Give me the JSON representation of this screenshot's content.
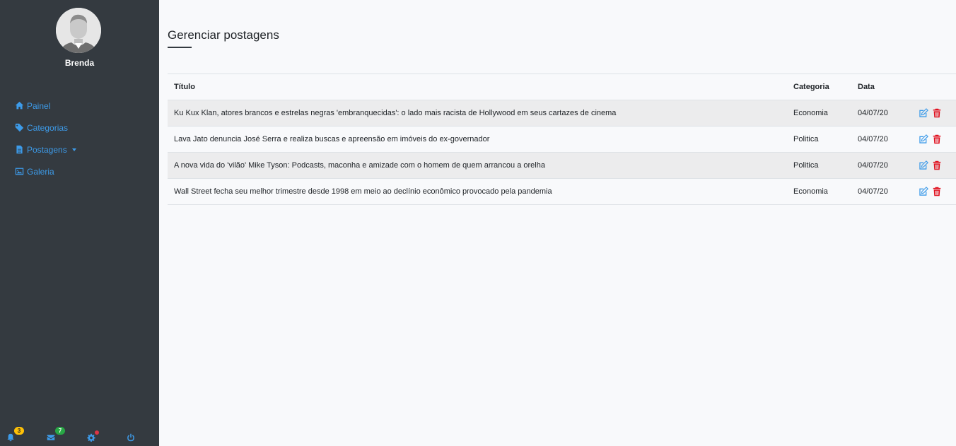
{
  "user": {
    "name": "Brenda"
  },
  "sidebar": {
    "items": [
      {
        "label": "Painel",
        "icon": "home-icon"
      },
      {
        "label": "Categorias",
        "icon": "tag-icon"
      },
      {
        "label": "Postagens",
        "icon": "file-icon",
        "has_dropdown": true
      },
      {
        "label": "Galeria",
        "icon": "image-icon"
      }
    ],
    "footer": {
      "notifications_count": "3",
      "messages_count": "7",
      "settings_icon": "gear-icon",
      "power_icon": "power-icon"
    }
  },
  "main": {
    "title": "Gerenciar postagens",
    "table": {
      "headers": {
        "title": "Título",
        "category": "Categoria",
        "date": "Data"
      },
      "rows": [
        {
          "title": "Ku Kux Klan, atores brancos e estrelas negras 'embranquecidas': o lado mais racista de Hollywood em seus cartazes de cinema",
          "category": "Economia",
          "date": "04/07/20"
        },
        {
          "title": "Lava Jato denuncia José Serra e realiza buscas e apreensão em imóveis do ex-governador",
          "category": "Politica",
          "date": "04/07/20"
        },
        {
          "title": "A nova vida do 'vilão' Mike Tyson: Podcasts, maconha e amizade com o homem de quem arrancou a orelha",
          "category": "Politica",
          "date": "04/07/20"
        },
        {
          "title": "Wall Street fecha seu melhor trimestre desde 1998 em meio ao declínio econômico provocado pela pandemia",
          "category": "Economia",
          "date": "04/07/20"
        }
      ]
    }
  },
  "colors": {
    "sidebar_bg": "#343a40",
    "accent": "#3d9be9",
    "delete": "#dc3545",
    "badge_yellow": "#ffc107",
    "badge_green": "#28a745"
  }
}
